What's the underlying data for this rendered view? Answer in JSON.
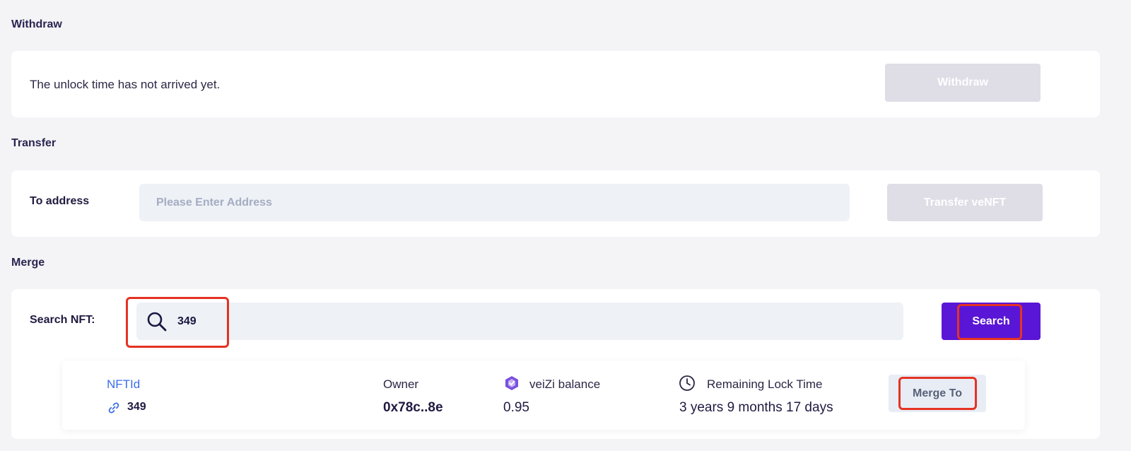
{
  "withdraw": {
    "title": "Withdraw",
    "message": "The unlock time has not arrived yet.",
    "button_label": "Withdraw"
  },
  "transfer": {
    "title": "Transfer",
    "to_address_label": "To address",
    "address_placeholder": "Please Enter Address",
    "button_label": "Transfer veNFT"
  },
  "merge": {
    "title": "Merge",
    "search_label": "Search NFT:",
    "search_value": "349",
    "search_button_label": "Search",
    "result": {
      "nft_id_label": "NFTId",
      "nft_id_value": "349",
      "owner_label": "Owner",
      "owner_value": "0x78c..8e",
      "balance_label": "veiZi balance",
      "balance_value": "0.95",
      "lock_label": "Remaining Lock Time",
      "lock_value": "3 years 9 months 17 days",
      "merge_button_label": "Merge To"
    }
  },
  "colors": {
    "accent": "#5a16d6",
    "link": "#3a6ee8",
    "highlight": "#e53222"
  }
}
